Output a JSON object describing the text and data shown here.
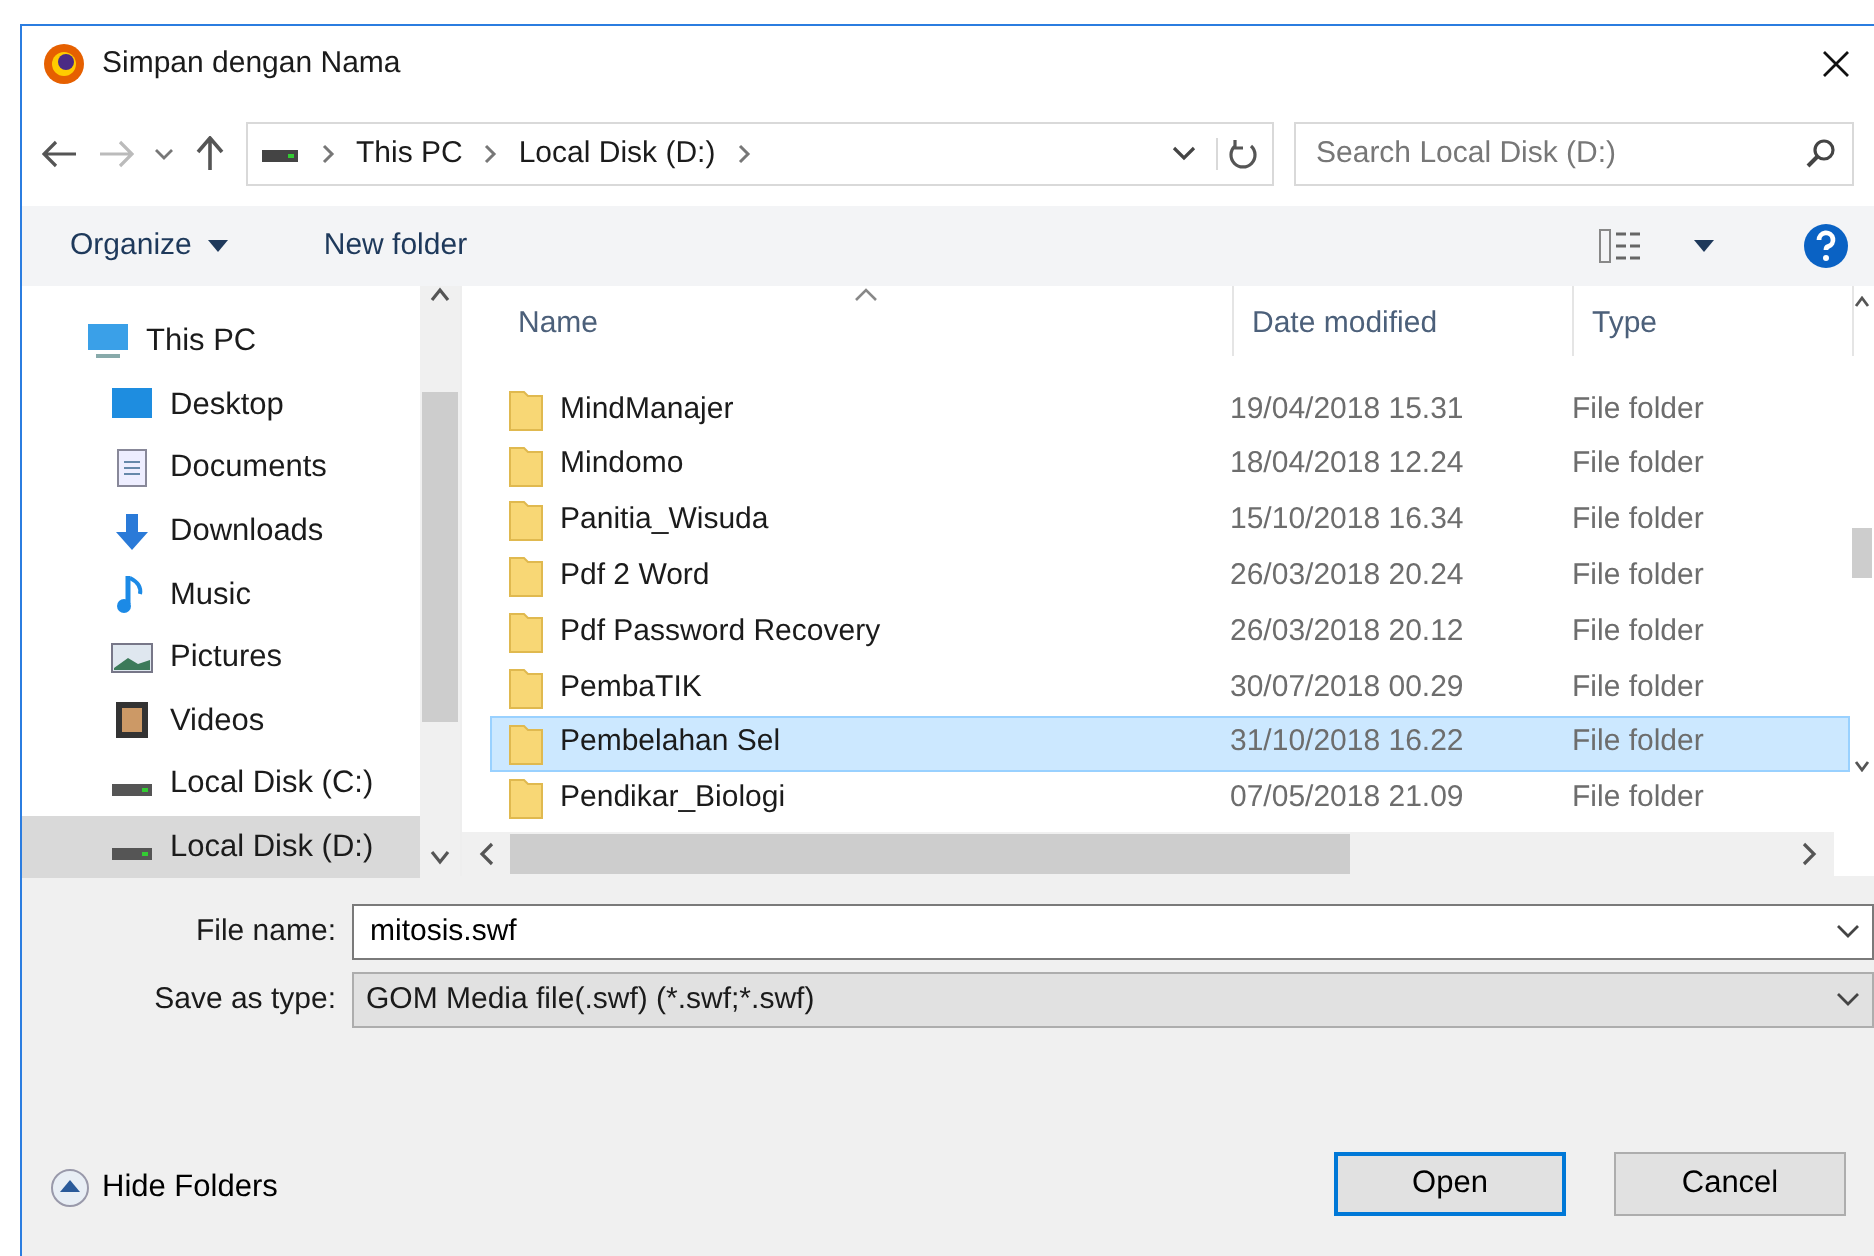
{
  "window": {
    "title": "Simpan dengan Nama"
  },
  "address": {
    "path": [
      "This PC",
      "Local Disk (D:)"
    ]
  },
  "search": {
    "placeholder": "Search Local Disk (D:)"
  },
  "toolbar": {
    "buttons": [
      "Organize",
      "New folder"
    ]
  },
  "sidebar": {
    "items": [
      {
        "label": "This PC",
        "kind": "pc",
        "selected": false,
        "children": [
          {
            "label": "Desktop",
            "kind": "desktop",
            "selected": false
          },
          {
            "label": "Documents",
            "kind": "documents",
            "selected": false
          },
          {
            "label": "Downloads",
            "kind": "downloads",
            "selected": false
          },
          {
            "label": "Music",
            "kind": "music",
            "selected": false
          },
          {
            "label": "Pictures",
            "kind": "pictures",
            "selected": false
          },
          {
            "label": "Videos",
            "kind": "videos",
            "selected": false
          },
          {
            "label": "Local Disk (C:)",
            "kind": "disk",
            "selected": false
          },
          {
            "label": "Local Disk (D:)",
            "kind": "disk",
            "selected": true
          }
        ]
      }
    ]
  },
  "table": {
    "columns": [
      "Name",
      "Date modified",
      "Type"
    ],
    "rows": [
      {
        "name": "MindManajer",
        "date": "19/04/2018 15.31",
        "type": "File folder",
        "selected": false
      },
      {
        "name": "Mindomo",
        "date": "18/04/2018 12.24",
        "type": "File folder",
        "selected": false
      },
      {
        "name": "Panitia_Wisuda",
        "date": "15/10/2018 16.34",
        "type": "File folder",
        "selected": false
      },
      {
        "name": "Pdf 2 Word",
        "date": "26/03/2018 20.24",
        "type": "File folder",
        "selected": false
      },
      {
        "name": "Pdf Password Recovery",
        "date": "26/03/2018 20.12",
        "type": "File folder",
        "selected": false
      },
      {
        "name": "PembaTIK",
        "date": "30/07/2018 00.29",
        "type": "File folder",
        "selected": false
      },
      {
        "name": "Pembelahan Sel",
        "date": "31/10/2018 16.22",
        "type": "File folder",
        "selected": true
      },
      {
        "name": "Pendikar_Biologi",
        "date": "07/05/2018 21.09",
        "type": "File folder",
        "selected": false
      }
    ]
  },
  "form": {
    "file_name_label": "File name:",
    "file_name": "mitosis.swf",
    "type_label": "Save as type:",
    "type_value": "GOM Media file(.swf) (*.swf;*.swf)"
  },
  "hide_folders": "Hide Folders",
  "buttons": [
    {
      "label": "Open",
      "default": true
    },
    {
      "label": "Cancel",
      "default": false
    }
  ]
}
